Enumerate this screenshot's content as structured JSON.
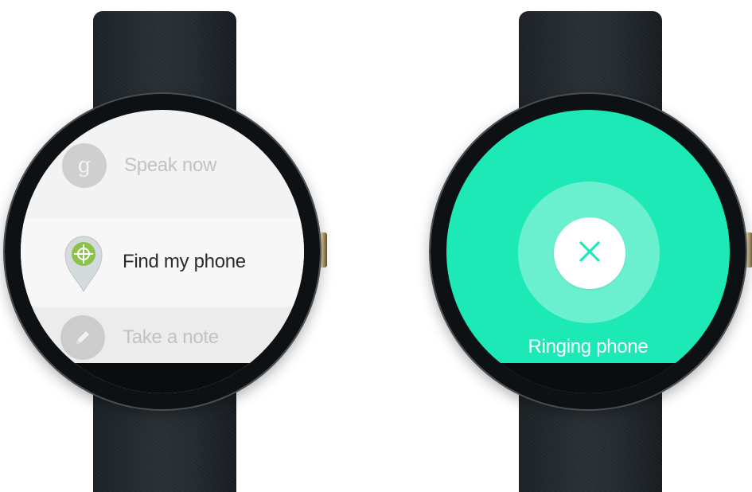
{
  "left_watch": {
    "items": [
      {
        "label": "Speak now",
        "icon": "google-g-icon",
        "icon_glyph": "g",
        "state": "dimmed"
      },
      {
        "label": "Find my phone",
        "icon": "find-phone-pin-icon",
        "state": "selected"
      },
      {
        "label": "Take a note",
        "icon": "pencil-icon",
        "state": "dimmed"
      }
    ]
  },
  "right_watch": {
    "status_label": "Ringing phone",
    "dismiss_icon": "close-icon"
  },
  "colors": {
    "accent_teal": "#1de9b6",
    "pin_green": "#8bc34a",
    "strap": "#252c31"
  }
}
